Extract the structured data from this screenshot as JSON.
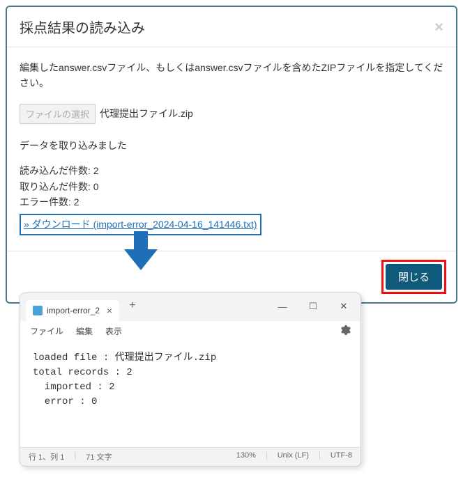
{
  "modal": {
    "title": "採点結果の読み込み",
    "instruction": "編集したanswer.csvファイル、もしくはanswer.csvファイルを含めたZIPファイルを指定してください。",
    "file_button": "ファイルの選択",
    "file_name": "代理提出ファイル.zip",
    "status_message": "データを取り込みました",
    "read_count_label": "読み込んだ件数:",
    "read_count_value": "2",
    "imported_count_label": "取り込んだ件数:",
    "imported_count_value": "0",
    "error_count_label": "エラー件数:",
    "error_count_value": "2",
    "download_link": "» ダウンロード (import-error_2024-04-16_141446.txt)",
    "close_button": "閉じる"
  },
  "editor": {
    "tab_title": "import-error_2",
    "menu": {
      "file": "ファイル",
      "edit": "編集",
      "view": "表示"
    },
    "content_line1": "loaded file : 代理提出ファイル.zip",
    "content_line2": "total records : 2",
    "content_line3": "  imported : 2",
    "content_line4": "  error : 0",
    "status": {
      "pos": "行 1、列 1",
      "chars": "71 文字",
      "zoom": "130%",
      "eol": "Unix (LF)",
      "enc": "UTF-8"
    }
  }
}
